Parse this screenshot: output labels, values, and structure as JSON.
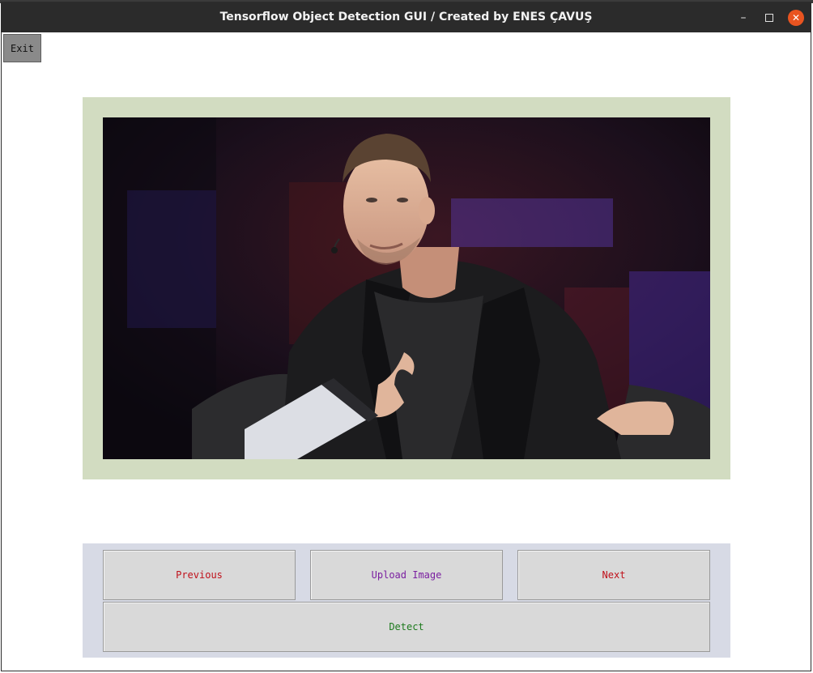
{
  "window": {
    "title": "Tensorflow Object Detection GUI / Created by ENES ÇAVUŞ",
    "controls": {
      "minimize_icon": "minimize-icon",
      "maximize_icon": "maximize-icon",
      "close_icon": "close-icon"
    }
  },
  "toolbar": {
    "exit_label": "Exit"
  },
  "image_view": {
    "image": "photo of a man in a dark blazer seated on stage, holding a clipboard out of frame"
  },
  "controls": {
    "previous_label": "Previous",
    "upload_label": "Upload Image",
    "next_label": "Next",
    "detect_label": "Detect"
  },
  "colors": {
    "frame_background": "#d2dcc1",
    "controls_background": "#d7dae5",
    "previous_text": "#c0101a",
    "upload_text": "#7a1fa0",
    "next_text": "#c0101a",
    "detect_text": "#1d7a1d",
    "close_button": "#e95420"
  }
}
